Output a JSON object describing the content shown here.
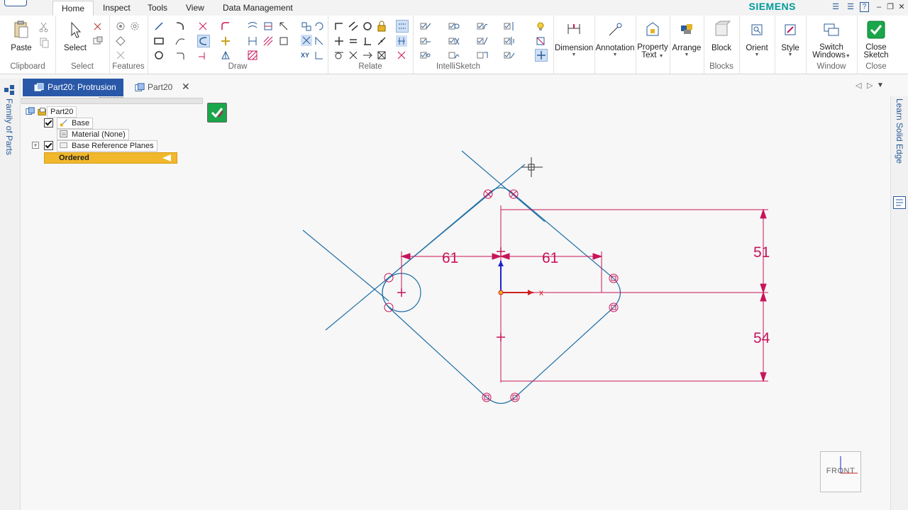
{
  "ribbon_tabs": [
    "Home",
    "Inspect",
    "Tools",
    "View",
    "Data Management"
  ],
  "active_tab": "Home",
  "brand": "SIEMENS",
  "groups": {
    "clipboard": {
      "label": "Clipboard",
      "paste": "Paste"
    },
    "select": {
      "label": "Select",
      "select": "Select"
    },
    "features": {
      "label": "Features"
    },
    "draw": {
      "label": "Draw"
    },
    "relate": {
      "label": "Relate"
    },
    "intellisketch": {
      "label": "IntelliSketch"
    },
    "dimension": {
      "label": "Dimension"
    },
    "annotation": {
      "label": "Annotation"
    },
    "property_text": {
      "line1": "Property",
      "line2": "Text"
    },
    "arrange": {
      "label": "Arrange"
    },
    "blocks": {
      "label": "Blocks",
      "block": "Block"
    },
    "orient": {
      "label": "Orient"
    },
    "style": {
      "label": "Style"
    },
    "window": {
      "label": "Window",
      "line1": "Switch",
      "line2": "Windows"
    },
    "close": {
      "label": "Close",
      "line1": "Close",
      "line2": "Sketch"
    }
  },
  "doc_tabs": {
    "active": "Part20: Protrusion",
    "second": "Part20"
  },
  "side_panels": {
    "left": "Family of Parts",
    "right": "Learn Solid Edge"
  },
  "tree": {
    "root": "Part20",
    "base": "Base",
    "material": "Material (None)",
    "planes": "Base Reference Planes",
    "ordered": "Ordered"
  },
  "dimensions": {
    "left_horizontal": "61",
    "right_horizontal": "61",
    "upper_vertical": "51",
    "lower_vertical": "54"
  },
  "axis_label": "x",
  "view_cube": "FRONT",
  "colors": {
    "accent": "#2a58a8",
    "dimension": "#c8145a",
    "sketch": "#1f6fa6",
    "ordered": "#f1b82c",
    "brand": "#009999"
  }
}
